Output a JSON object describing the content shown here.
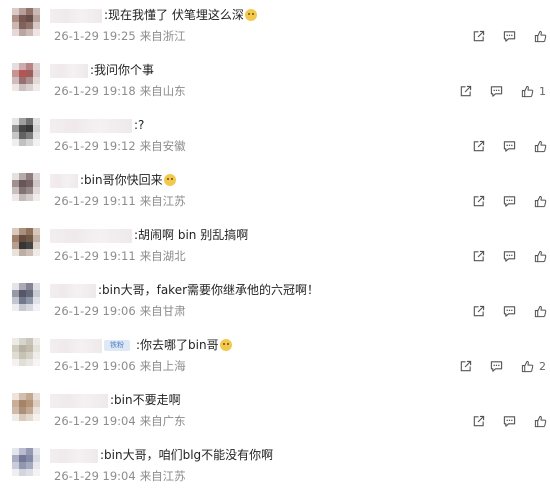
{
  "comments": [
    {
      "text": ":现在我懂了 伏笔埋这么深",
      "emoji": true,
      "date": "26-1-29 19:25",
      "location": "来自浙江",
      "likes": ""
    },
    {
      "text": ":我问你个事",
      "emoji": false,
      "date": "26-1-29 19:18",
      "location": "来自山东",
      "likes": "1"
    },
    {
      "text": ":?",
      "emoji": false,
      "date": "26-1-29 19:12",
      "location": "来自安徽",
      "likes": ""
    },
    {
      "text": ":bin哥你快回来",
      "emoji": true,
      "date": "26-1-29 19:11",
      "location": "来自江苏",
      "likes": ""
    },
    {
      "text": ":胡闹啊 bin 别乱搞啊",
      "emoji": false,
      "date": "26-1-29 19:11",
      "location": "来自湖北",
      "likes": ""
    },
    {
      "text": ":bin大哥，faker需要你继承他的六冠啊！",
      "emoji": false,
      "date": "26-1-29 19:06",
      "location": "来自甘肃",
      "likes": ""
    },
    {
      "text": ":你去哪了bin哥",
      "emoji": true,
      "date": "26-1-29 19:06",
      "location": "来自上海",
      "likes": "2",
      "badge": "铁粉"
    },
    {
      "text": ":bin不要走啊",
      "emoji": false,
      "date": "26-1-29 19:04",
      "location": "来自广东",
      "likes": ""
    },
    {
      "text": ":bin大哥，咱们blg不能没有你啊",
      "emoji": false,
      "date": "26-1-29 19:04",
      "location": "来自江苏",
      "likes": ""
    }
  ],
  "icons": {
    "share": "share-icon",
    "comment": "comment-icon",
    "like": "like-icon",
    "emoji": "grinning-emoji-icon"
  },
  "colors": {
    "meta": "#8c8c8c",
    "text": "#222222",
    "icon": "#555555",
    "badge": "#4a7fc1"
  }
}
